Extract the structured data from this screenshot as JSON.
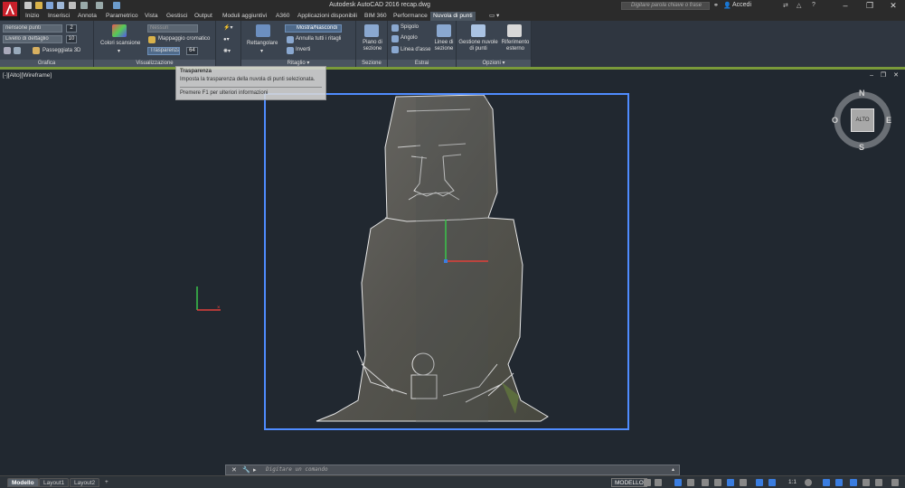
{
  "app": {
    "window_title": "Autodesk AutoCAD 2016    recap.dwg",
    "search_placeholder": "Digitare parola chiave o frase",
    "signin_label": "Accedi",
    "minimize": "–",
    "restore": "❐",
    "close": "✕"
  },
  "tabs": [
    "Inizio",
    "Inserisci",
    "Annota",
    "Parametrico",
    "Vista",
    "Gestisci",
    "Output",
    "Moduli aggiuntivi",
    "A360",
    "Applicazioni disponibili",
    "BIM 360",
    "Performance",
    "Nuvola di punti"
  ],
  "active_tab": "Nuvola di punti",
  "ribbon": {
    "grafica": {
      "title": "Grafica",
      "dimension_label": "nensione punti",
      "dimension_value": "2",
      "detail_label": "Livello di dettaglio",
      "detail_value": "10",
      "walkthrough_label": "Passeggiata 3D"
    },
    "visualizzazione": {
      "title": "Visualizzazione",
      "scan_colors_label": "Colori scansione",
      "dropdown_value": "Nessun",
      "color_mapping_label": "Mappaggio cromatico",
      "transparency_label": "Trasparenza",
      "transparency_value": "64"
    },
    "ritaglio": {
      "title": "Ritaglio",
      "rectangular_label": "Rettangolare",
      "show_hide_label": "Mostra/Nascondi",
      "cancel_all_label": "Annulla tutti i ritagli",
      "invert_label": "Inverti"
    },
    "sezione": {
      "title": "Sezione",
      "section_plane_label": "Piano di sezione"
    },
    "estrai": {
      "title": "Estrai",
      "edge_label": "Spigolo",
      "corner_label": "Angolo",
      "centerline_label": "Linea d'asse",
      "section_lines_label": "Linee di sezione"
    },
    "opzioni": {
      "title": "Opzioni",
      "manage_label": "Gestione nuvole di punti",
      "external_ref_label": "Riferimento esterno"
    }
  },
  "tooltip": {
    "title": "Trasparenza",
    "description": "Imposta la trasparenza della nuvola di punti selezionata.",
    "help": "Premere F1 per ulteriori informazioni"
  },
  "viewport": {
    "label": "[-][Alto][Wireframe]",
    "controls": "– ❐ ✕"
  },
  "viewcube": {
    "face": "ALTO",
    "north": "N",
    "south": "S",
    "east": "E",
    "west": "O"
  },
  "command": {
    "placeholder": "Digitare un comando"
  },
  "layouts": [
    "Modello",
    "Layout1",
    "Layout2",
    "+"
  ],
  "status": {
    "model": "MODELLO",
    "scale": "1:1"
  }
}
